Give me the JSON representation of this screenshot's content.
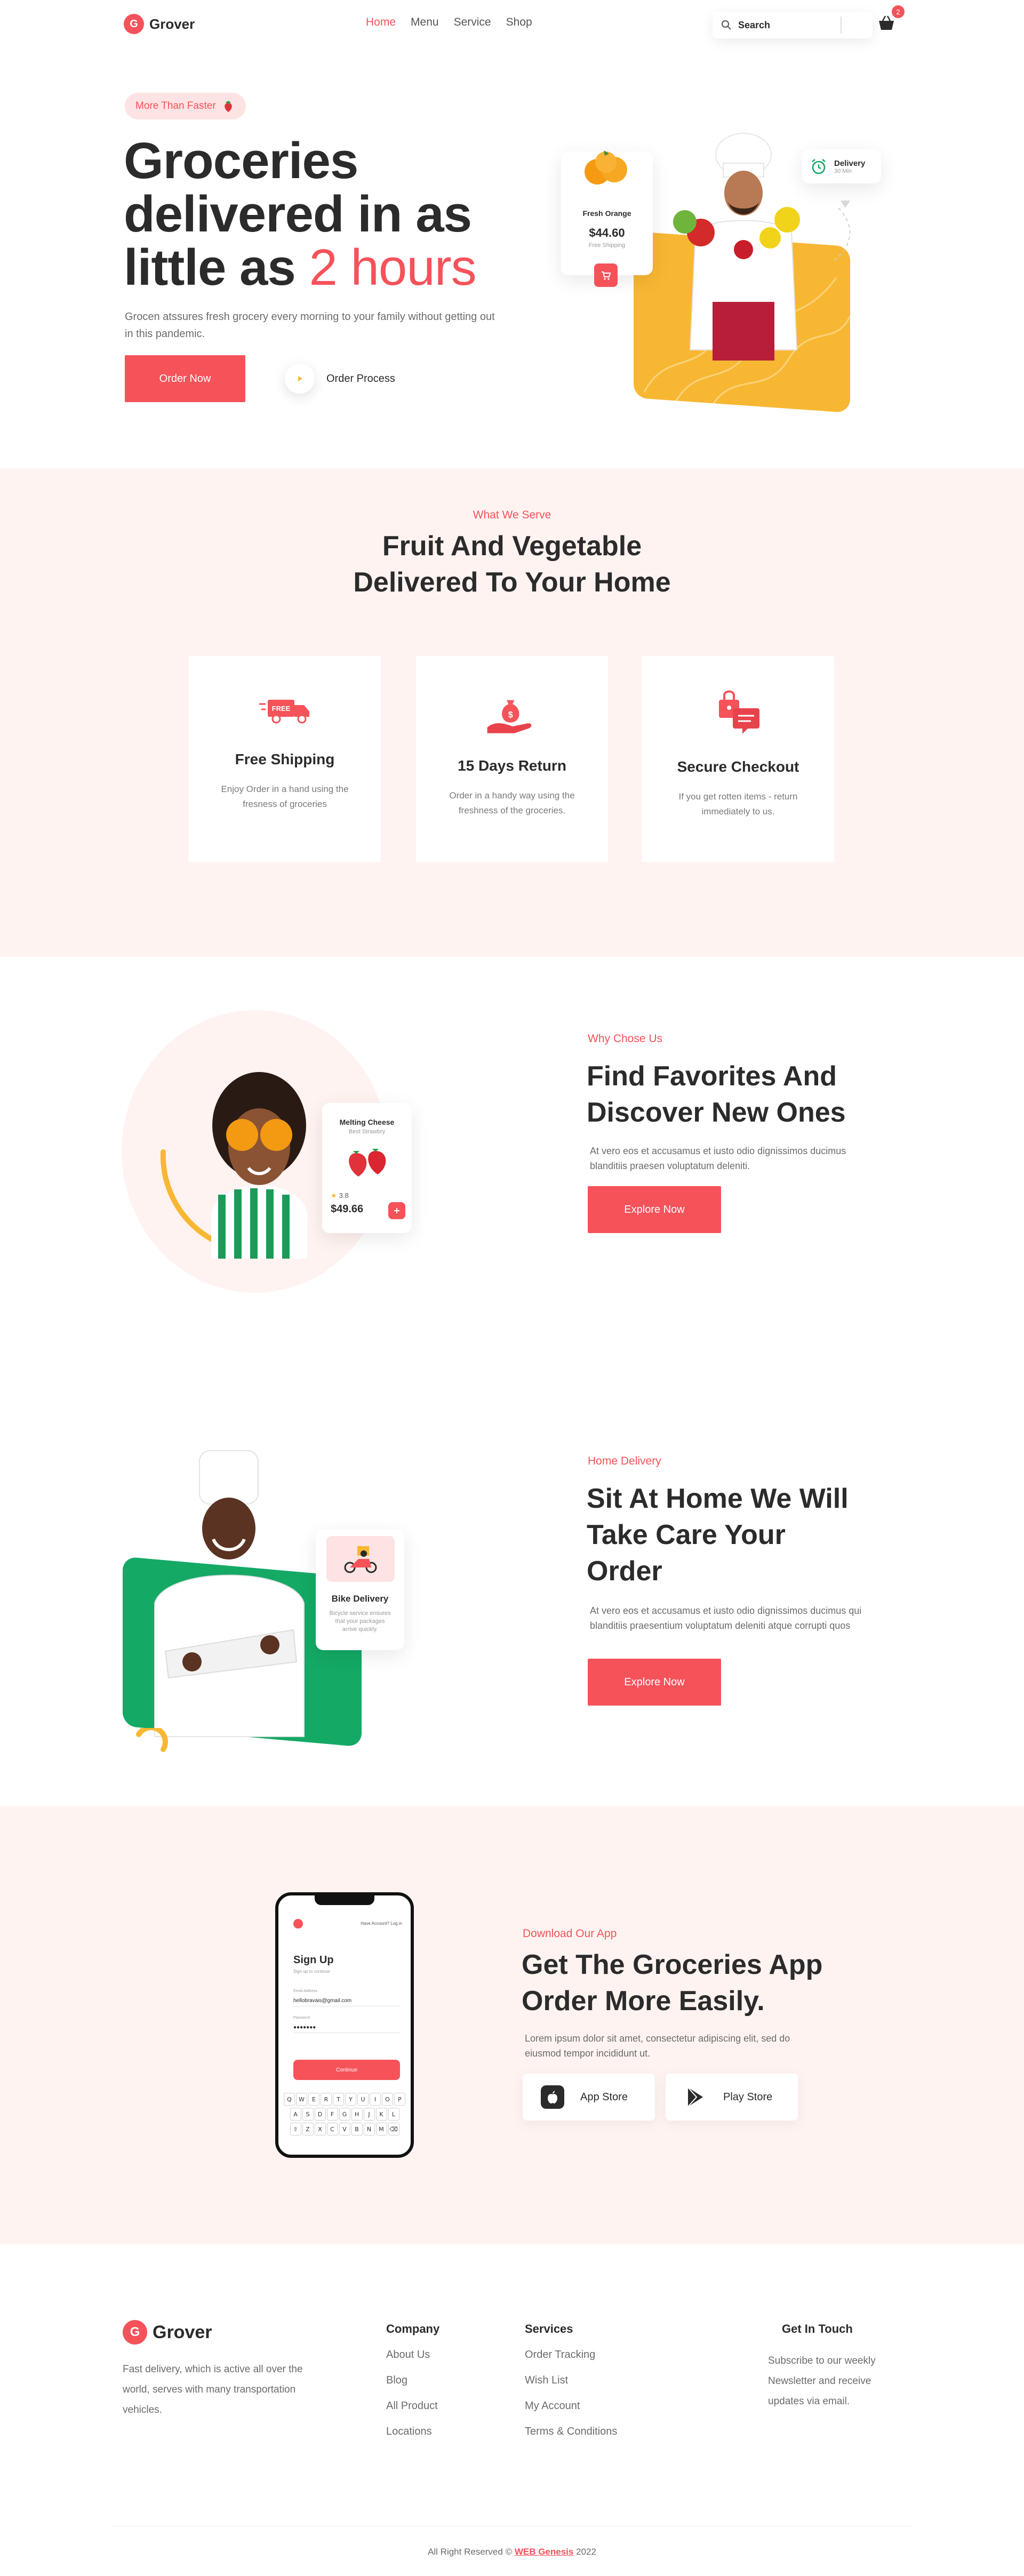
{
  "header": {
    "logo_text": "Grover",
    "logo_mark": "G",
    "nav": [
      "Home",
      "Menu",
      "Service",
      "Shop"
    ],
    "search_placeholder": "Search",
    "cart_count": "2"
  },
  "hero": {
    "pill": "More Than Faster",
    "title_line1": "Groceries",
    "title_line2": "delivered in as",
    "title_line3_prefix": "little as",
    "title_line3_accent": "2 hours",
    "description": "Grocen atssures fresh grocery every morning to your family without getting out in this pandemic.",
    "order_now": "Order Now",
    "order_process": "Order Process",
    "product_card": {
      "title": "Fresh Orange",
      "subtitle": "Free Shipping",
      "price": "$44.60"
    },
    "delivery_card": {
      "title": "Delivery",
      "subtitle": "30 Min"
    }
  },
  "serve": {
    "eyebrow": "What We Serve",
    "title_line1": "Fruit And Vegetable",
    "title_line2": "Delivered To Your Home",
    "features": [
      {
        "icon": "delivery-truck-icon",
        "badge": "FREE",
        "title": "Free Shipping",
        "desc": "Enjoy Order in a hand using the fresness of groceries"
      },
      {
        "icon": "money-bag-hand-icon",
        "title": "15 Days Return",
        "desc": "Order in a handy way using the freshness of the groceries."
      },
      {
        "icon": "secure-bag-icon",
        "title": "Secure Checkout",
        "desc": "If you get rotten items - return immediately to us."
      }
    ]
  },
  "why": {
    "eyebrow": "Why Chose Us",
    "title_line1": "Find Favorites And",
    "title_line2": "Discover New Ones",
    "description": "At vero eos et accusamus et iusto odio dignissimos ducimus blanditiis praesen voluptatum deleniti.",
    "button": "Explore Now",
    "product_card": {
      "title": "Melting Cheese",
      "subtitle": "Best Strawbry",
      "rating": "3.8",
      "price": "$49.66"
    }
  },
  "home_delivery": {
    "eyebrow": "Home Delivery",
    "title_line1": "Sit At Home We Will",
    "title_line2": "Take Care Your",
    "title_line3": "Order",
    "description": "At vero eos et accusamus et iusto odio dignissimos ducimus qui blanditiis praesentium voluptatum deleniti atque corrupti quos",
    "button": "Explore Now",
    "card": {
      "title": "Bike Delivery",
      "desc": "Bicycle service ensures that your packages arrive quickly."
    }
  },
  "app": {
    "eyebrow": "Download Our App",
    "title_line1": "Get The Groceries App",
    "title_line2": "Order More Easily.",
    "description": "Lorem ipsum dolor sit amet, consectetur adipiscing elit, sed do eiusmod tempor incididunt ut.",
    "app_store": "App Store",
    "play_store": "Play Store",
    "phone": {
      "top_link": "Have Account? Log in",
      "heading": "Sign Up",
      "sub": "Sign up to continue",
      "email_label": "Email Address",
      "email_value": "hellobravais@gmail.com",
      "password_label": "Password",
      "password_value": "●●●●●●●",
      "continue": "Continue",
      "keys_row1": [
        "Q",
        "W",
        "E",
        "R",
        "T",
        "Y",
        "U",
        "I",
        "O",
        "P"
      ],
      "keys_row2": [
        "A",
        "S",
        "D",
        "F",
        "G",
        "H",
        "J",
        "K",
        "L"
      ],
      "keys_row3": [
        "⇧",
        "Z",
        "X",
        "C",
        "V",
        "B",
        "N",
        "M",
        "⌫"
      ]
    }
  },
  "footer": {
    "logo_text": "Grover",
    "about": "Fast delivery, which is active all over the world, serves with many transportation vehicles.",
    "company": {
      "title": "Company",
      "links": [
        "About Us",
        "Blog",
        "All Product",
        "Locations"
      ]
    },
    "services": {
      "title": "Services",
      "links": [
        "Order Tracking",
        "Wish List",
        "My Account",
        "Terms & Conditions"
      ]
    },
    "contact": {
      "title": "Get In Touch",
      "text": "Subscribe to our weekly Newsletter and receive updates via email."
    },
    "copyright_prefix": "All Right Reserved ©",
    "copyright_link": "WEB Genesis",
    "copyright_year": "2022"
  },
  "colors": {
    "accent": "#f5525a",
    "yellow": "#f8b733",
    "green": "#14a965",
    "pink_bg": "#fff3f1",
    "text": "#2b2b2b"
  }
}
